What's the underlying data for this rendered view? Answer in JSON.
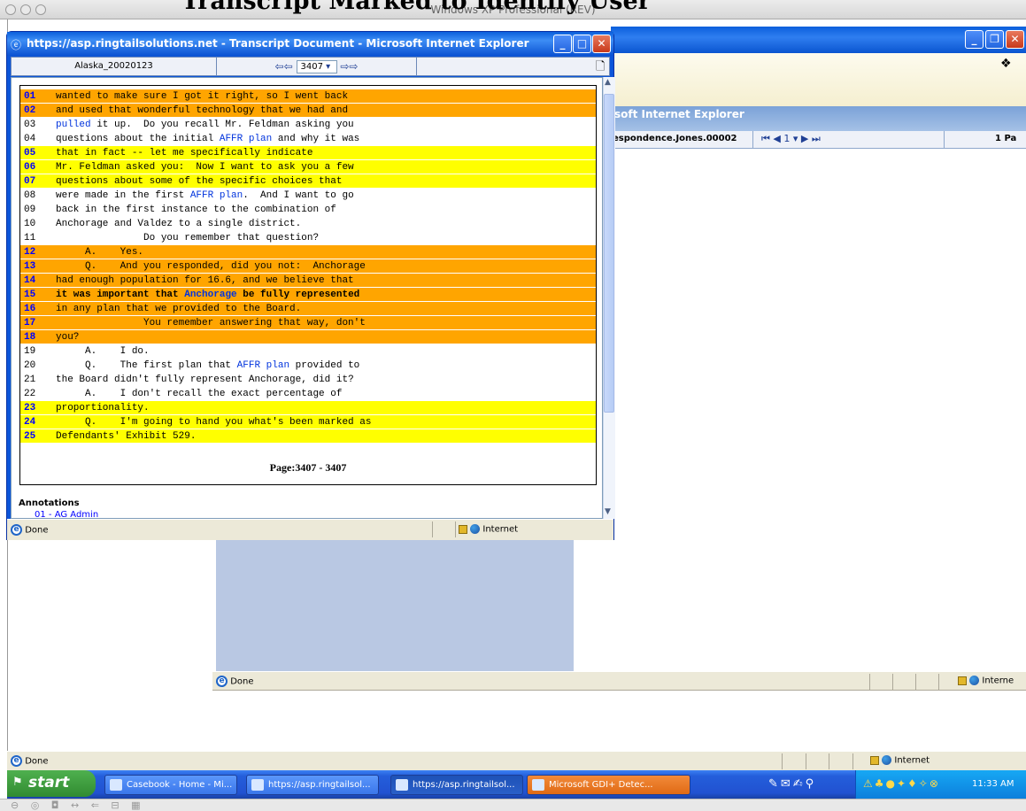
{
  "slide_title": "Transcript Marked to Identify User",
  "mac_window_title": "Windows XP Professional (REV)",
  "mac_bottom_icons": "⊖ ◎ ◘ ↔ ⇐ ⊟ ▦",
  "back_window": {
    "title": "soft Internet Explorer",
    "doc_name": "espondence.Jones.00002",
    "pager": "⏮ ◀ 1 ▾ ▶ ⏭",
    "pages": "1 Pa",
    "status_done": "Done",
    "status_zone": "Interne"
  },
  "popup": {
    "title": "https://asp.ringtailsolutions.net - Transcript Document - Microsoft Internet Explorer",
    "doc_name": "Alaska_20020123",
    "page_value": "3407",
    "status_done": "Done",
    "status_zone": "Internet",
    "page_footer": "Page:3407 - 3407",
    "annotations_heading": "Annotations",
    "annotations_first": "01 - AG Admin"
  },
  "transcript_lines": [
    {
      "no": "01",
      "hl": "orange",
      "text": "wanted to make sure I got it right, so I went back"
    },
    {
      "no": "02",
      "hl": "orange",
      "text": "and used that wonderful technology that we had and"
    },
    {
      "no": "03",
      "hl": "none",
      "text": "pulled it up.  Do you recall Mr. Feldman asking you"
    },
    {
      "no": "04",
      "hl": "none",
      "text": "questions about the initial AFFR plan and why it was"
    },
    {
      "no": "05",
      "hl": "yellow",
      "text": "that in fact -- let me specifically indicate"
    },
    {
      "no": "06",
      "hl": "yellow",
      "text": "Mr. Feldman asked you:  Now I want to ask you a few"
    },
    {
      "no": "07",
      "hl": "yellow",
      "text": "questions about some of the specific choices that"
    },
    {
      "no": "08",
      "hl": "none",
      "text": "were made in the first AFFR plan.  And I want to go"
    },
    {
      "no": "09",
      "hl": "none",
      "text": "back in the first instance to the combination of"
    },
    {
      "no": "10",
      "hl": "none",
      "text": "Anchorage and Valdez to a single district."
    },
    {
      "no": "11",
      "hl": "none",
      "text": "               Do you remember that question?"
    },
    {
      "no": "12",
      "hl": "orange",
      "text": "     A.    Yes."
    },
    {
      "no": "13",
      "hl": "orange",
      "text": "     Q.    And you responded, did you not:  Anchorage"
    },
    {
      "no": "14",
      "hl": "orange",
      "text": "had enough population for 16.6, and we believe that"
    },
    {
      "no": "15",
      "hl": "orange",
      "text": "it was important that Anchorage be fully represented",
      "bold": true
    },
    {
      "no": "16",
      "hl": "orange",
      "text": "in any plan that we provided to the Board."
    },
    {
      "no": "17",
      "hl": "orange",
      "text": "               You remember answering that way, don't"
    },
    {
      "no": "18",
      "hl": "orange",
      "text": "you?"
    },
    {
      "no": "19",
      "hl": "none",
      "text": "     A.    I do."
    },
    {
      "no": "20",
      "hl": "none",
      "text": "     Q.    The first plan that AFFR plan provided to"
    },
    {
      "no": "21",
      "hl": "none",
      "text": "the Board didn't fully represent Anchorage, did it?"
    },
    {
      "no": "22",
      "hl": "none",
      "text": "     A.    I don't recall the exact percentage of"
    },
    {
      "no": "23",
      "hl": "yellow",
      "text": "proportionality."
    },
    {
      "no": "24",
      "hl": "yellow",
      "text": "     Q.    I'm going to hand you what's been marked as"
    },
    {
      "no": "25",
      "hl": "yellow",
      "text": "Defendants' Exhibit 529."
    }
  ],
  "outer_status": {
    "done": "Done",
    "zone": "Internet"
  },
  "taskbar": {
    "start": "start",
    "tasks": [
      "Casebook - Home - Mi...",
      "https://asp.ringtailsol...",
      "https://asp.ringtailsol...",
      "Microsoft GDI+ Detec..."
    ],
    "clock": "11:33 AM"
  },
  "colors": {
    "orange": "#ffa500",
    "yellow": "#ffff00",
    "xp_blue": "#0c55d9"
  }
}
